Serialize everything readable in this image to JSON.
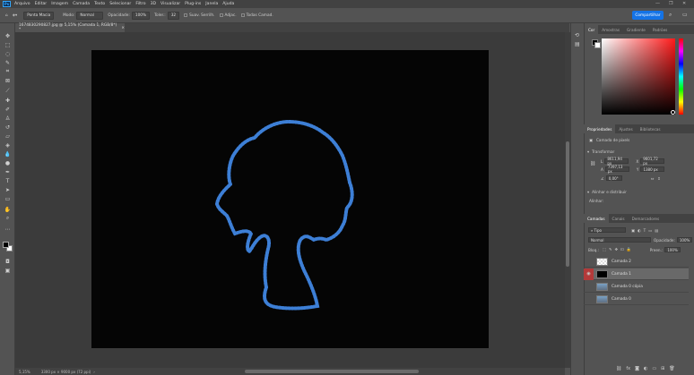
{
  "app": {
    "logo_text": "Ps",
    "menu": [
      "Arquivo",
      "Editar",
      "Imagem",
      "Camada",
      "Texto",
      "Selecionar",
      "Filtro",
      "3D",
      "Visualizar",
      "Plug-ins",
      "Janela",
      "Ajuda"
    ],
    "window_controls": [
      "—",
      "❐",
      "✕"
    ]
  },
  "options_bar": {
    "preset": "Ponta Macia",
    "mode_label": "Modo:",
    "mode_value": "Normal",
    "opacity_label": "Opacidade:",
    "opacity_value": "100%",
    "tolerance_label": "Toler.:",
    "tolerance_value": "32",
    "smoothing_label": "Suav. Serrilh.",
    "adjacent_label": "Adjac.",
    "all_layers_label": "Todas Camad.",
    "share_label": "Compartilhar"
  },
  "document": {
    "tab_title": "1674830290827.jpg @ 5,15% (Camada 1, RGB/8*) *",
    "zoom": "5,15%",
    "size_info": "3300 px × 9000 px (72 ppi)"
  },
  "color_panel": {
    "tabs": [
      "Cor",
      "Amostras",
      "Gradiente",
      "Padrões"
    ],
    "active_tab": "Cor",
    "foreground": "#000000",
    "background": "#ffffff"
  },
  "properties_panel": {
    "tabs": [
      "Propriedades",
      "Ajustes",
      "Bibliotecas"
    ],
    "active_tab": "Propriedades",
    "layer_kind": "Camada de pixels",
    "transform_label": "Transformar",
    "W_label": "L",
    "W_value": "8611,94 px",
    "X_label": "X",
    "X_value": "9601,72 px",
    "H_label": "A",
    "H_value": "7397,13 px",
    "Y_label": "Y",
    "Y_value": "1380 px",
    "angle_value": "0,00°",
    "align_label": "Alinhar e distribuir",
    "align_more": "Alinhar:"
  },
  "layers_panel": {
    "tabs": [
      "Camadas",
      "Canais",
      "Demarcadores"
    ],
    "active_tab": "Camadas",
    "filter_kind": "Tipo",
    "blend_mode": "Normal",
    "opacity_label": "Opacidade:",
    "opacity_value": "100%",
    "lock_label": "Bloq.:",
    "fill_label": "Preen.:",
    "fill_value": "100%",
    "layers": [
      {
        "name": "Camada 2",
        "visible": false,
        "selected": false,
        "thumb": "checker"
      },
      {
        "name": "Camada 1",
        "visible": true,
        "selected": true,
        "thumb": "black"
      },
      {
        "name": "Camada 0 cópia",
        "visible": false,
        "selected": false,
        "thumb": "photo"
      },
      {
        "name": "Camada 0",
        "visible": false,
        "selected": false,
        "thumb": "photo"
      }
    ]
  },
  "colors": {
    "accent": "#1473e6",
    "outline": "#3d7fd6",
    "canvas": "#050505"
  }
}
